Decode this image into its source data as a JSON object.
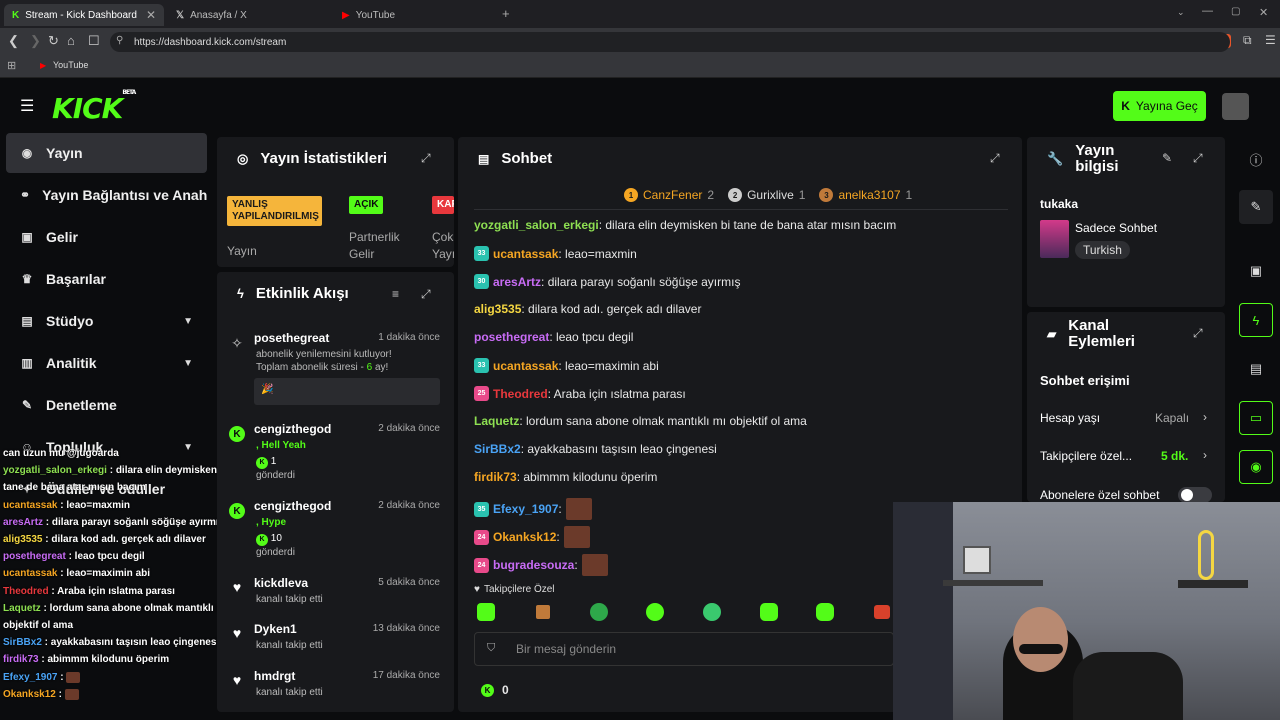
{
  "browser": {
    "tabs": [
      {
        "label": "Stream - Kick Dashboard"
      },
      {
        "label": "Anasayfa / X"
      },
      {
        "label": "YouTube"
      }
    ],
    "url": "https://dashboard.kick.com/stream",
    "bookmark": "YouTube"
  },
  "header": {
    "logo": "KICK",
    "logo_tag": "BETA",
    "go_live": "Yayına Geç"
  },
  "sidebar": {
    "items": [
      {
        "label": "Yayın"
      },
      {
        "label": "Yayın Bağlantısı ve Anahtarı"
      },
      {
        "label": "Gelir"
      },
      {
        "label": "Başarılar"
      },
      {
        "label": "Stüdyo"
      },
      {
        "label": "Analitik"
      },
      {
        "label": "Denetleme"
      },
      {
        "label": "Topluluk"
      },
      {
        "label": "Ödüller ve ödüller"
      }
    ]
  },
  "stats": {
    "title": "Yayın İstatistikleri",
    "items": [
      {
        "badge": "YANLIŞ YAPILANDIRILMIŞ",
        "label": "Yayın"
      },
      {
        "badge": "AÇIK",
        "label": "Partnerlik Gelir"
      },
      {
        "badge": "KAP",
        "label": "Çok Yayı"
      }
    ]
  },
  "activity": {
    "title": "Etkinlik Akışı",
    "items": [
      {
        "name": "posethegreat",
        "time": "1 dakika önce",
        "line1": "abonelik yenilemesini kutluyor!",
        "line2_pre": "Toplam abonelik süresi - ",
        "line2_num": "6",
        "line2_post": " ay!"
      },
      {
        "name": "cengizthegod",
        "time": "2 dakika önce",
        "msg": ", Hell Yeah",
        "amount": "1",
        "sent": "gönderdi"
      },
      {
        "name": "cengizthegod",
        "time": "2 dakika önce",
        "msg": ", Hype",
        "amount": "10",
        "sent": "gönderdi"
      },
      {
        "name": "kickdleva",
        "time": "5 dakika önce",
        "sub": "kanalı takip etti"
      },
      {
        "name": "Dyken1",
        "time": "13 dakika önce",
        "sub": "kanalı takip etti"
      },
      {
        "name": "hmdrgt",
        "time": "17 dakika önce",
        "sub": "kanalı takip etti"
      }
    ]
  },
  "chat": {
    "title": "Sohbet",
    "top_gifters": [
      {
        "rank": "1",
        "name": "CanzFener",
        "count": "2"
      },
      {
        "rank": "2",
        "name": "Gurixlive",
        "count": "1"
      },
      {
        "rank": "3",
        "name": "anelka3107",
        "count": "1"
      }
    ],
    "messages": [
      {
        "badge": "",
        "user": "yozgatli_salon_erkegi",
        "color": "#8ee052",
        "text": ": dilara elin deymisken bi tane de bana atar mısın bacım"
      },
      {
        "badge": "33",
        "user": "ucantassak",
        "color": "#f5a623",
        "text": ": leao=maxmin"
      },
      {
        "badge": "30",
        "user": "aresArtz",
        "color": "#c86cf5",
        "text": ": dilara parayı soğanlı söğüşe ayırmış"
      },
      {
        "badge": "",
        "user": "alig3535",
        "color": "#f5d742",
        "text": ": dilara kod adı. gerçek adı dilaver"
      },
      {
        "badge": "",
        "user": "posethegreat",
        "color": "#c86cf5",
        "text": ": leao tpcu degil"
      },
      {
        "badge": "33",
        "user": "ucantassak",
        "color": "#f5a623",
        "text": ": leao=maximin abi"
      },
      {
        "badge": "25",
        "user": "Theodred",
        "color": "#e8383d",
        "text": ": Araba için ıslatma parası"
      },
      {
        "badge": "",
        "user": "Laquetz",
        "color": "#8ee052",
        "text": ": lordum sana abone olmak mantıklı mı objektif ol ama"
      },
      {
        "badge": "",
        "user": "SirBBx2",
        "color": "#4aa3f5",
        "text": ": ayakkabasını taşısın leao çingenesi"
      },
      {
        "badge": "",
        "user": "firdik73",
        "color": "#f5a623",
        "text": ": abimmm kilodunu öperim"
      },
      {
        "badge": "35",
        "user": "Efexy_1907",
        "color": "#4aa3f5",
        "text": ":"
      },
      {
        "badge": "24",
        "user": "Okanksk12",
        "color": "#f5a623",
        "text": ":"
      },
      {
        "badge": "24",
        "user": "bugradesouza",
        "color": "#c86cf5",
        "text": ":"
      }
    ],
    "followers_only": "Takipçilere Özel",
    "input_placeholder": "Bir mesaj gönderin",
    "points": "0"
  },
  "stream_info": {
    "title": "Yayın bilgisi",
    "streamer": "tukaka",
    "category": "Sadece Sohbet",
    "tag": "Turkish"
  },
  "channel_actions": {
    "title": "Kanal Eylemleri",
    "section": "Sohbet erişimi",
    "rows": [
      {
        "label": "Hesap yaşı",
        "value": "Kapalı"
      },
      {
        "label": "Takipçilere özel...",
        "value": "5 dk."
      },
      {
        "label": "Abonelere özel sohbet",
        "value": ""
      }
    ]
  },
  "overlay_chat": [
    {
      "user": "",
      "text": "can uzun mu @jugoarda"
    },
    {
      "user": "yozgatli_salon_erkegi",
      "color": "#8ee052",
      "text": " : dilara elin deymisken bi"
    },
    {
      "user": "",
      "text": "tane de bana atar mısın bacım"
    },
    {
      "user": "ucantassak",
      "color": "#f5a623",
      "text": " : leao=maxmin"
    },
    {
      "user": "aresArtz",
      "color": "#c86cf5",
      "text": " : dilara parayı soğanlı söğüşe ayırmış"
    },
    {
      "user": "alig3535",
      "color": "#f5d742",
      "text": " : dilara kod adı. gerçek adı dilaver"
    },
    {
      "user": "posethegreat",
      "color": "#c86cf5",
      "text": " : leao tpcu degil"
    },
    {
      "user": "ucantassak",
      "color": "#f5a623",
      "text": " : leao=maximin abi"
    },
    {
      "user": "Theodred",
      "color": "#e8383d",
      "text": " : Araba için ıslatma parası"
    },
    {
      "user": "Laquetz",
      "color": "#8ee052",
      "text": " : lordum sana abone olmak mantıklı mı"
    },
    {
      "user": "",
      "text": "objektif ol ama"
    },
    {
      "user": "SirBBx2",
      "color": "#4aa3f5",
      "text": " : ayakkabasını taşısın leao çingenesi"
    },
    {
      "user": "firdik73",
      "color": "#c86cf5",
      "text": " : abimmm kilodunu öperim"
    },
    {
      "user": "Efexy_1907",
      "color": "#4aa3f5",
      "text": " :"
    },
    {
      "user": "Okanksk12",
      "color": "#f5a623",
      "text": " :"
    }
  ],
  "colors": {
    "accent": "#53fc18",
    "panel": "#18191c",
    "bg": "#0b0c0e"
  }
}
